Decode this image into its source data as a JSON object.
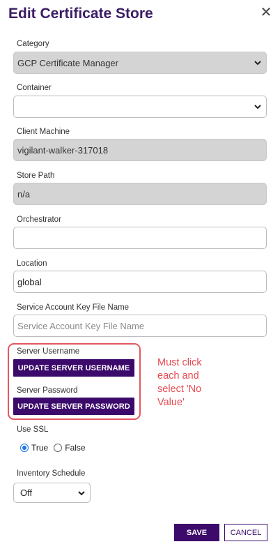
{
  "dialog": {
    "title": "Edit Certificate Store",
    "close_icon": "close-icon"
  },
  "form": {
    "category": {
      "label": "Category",
      "value": "GCP Certificate Manager"
    },
    "container": {
      "label": "Container",
      "value": ""
    },
    "client_machine": {
      "label": "Client Machine",
      "value": "vigilant-walker-317018"
    },
    "store_path": {
      "label": "Store Path",
      "value": "n/a"
    },
    "orchestrator": {
      "label": "Orchestrator",
      "value": ""
    },
    "location": {
      "label": "Location",
      "value": "global"
    },
    "service_account_key": {
      "label": "Service Account Key File Name",
      "placeholder": "Service Account Key File Name",
      "value": ""
    },
    "server_username": {
      "label": "Server Username",
      "button": "UPDATE SERVER USERNAME"
    },
    "server_password": {
      "label": "Server Password",
      "button": "UPDATE SERVER PASSWORD"
    },
    "use_ssl": {
      "label": "Use SSL",
      "options": [
        "True",
        "False"
      ],
      "selected": "True"
    },
    "inventory_schedule": {
      "label": "Inventory Schedule",
      "value": "Off"
    }
  },
  "annotation": {
    "lines": [
      "Must click",
      "each and",
      "select 'No",
      "Value'"
    ],
    "color": "#e84a52"
  },
  "footer": {
    "save": "SAVE",
    "cancel": "CANCEL"
  },
  "colors": {
    "primary": "#3c0a6b",
    "radio_selected": "#1a73e8"
  }
}
